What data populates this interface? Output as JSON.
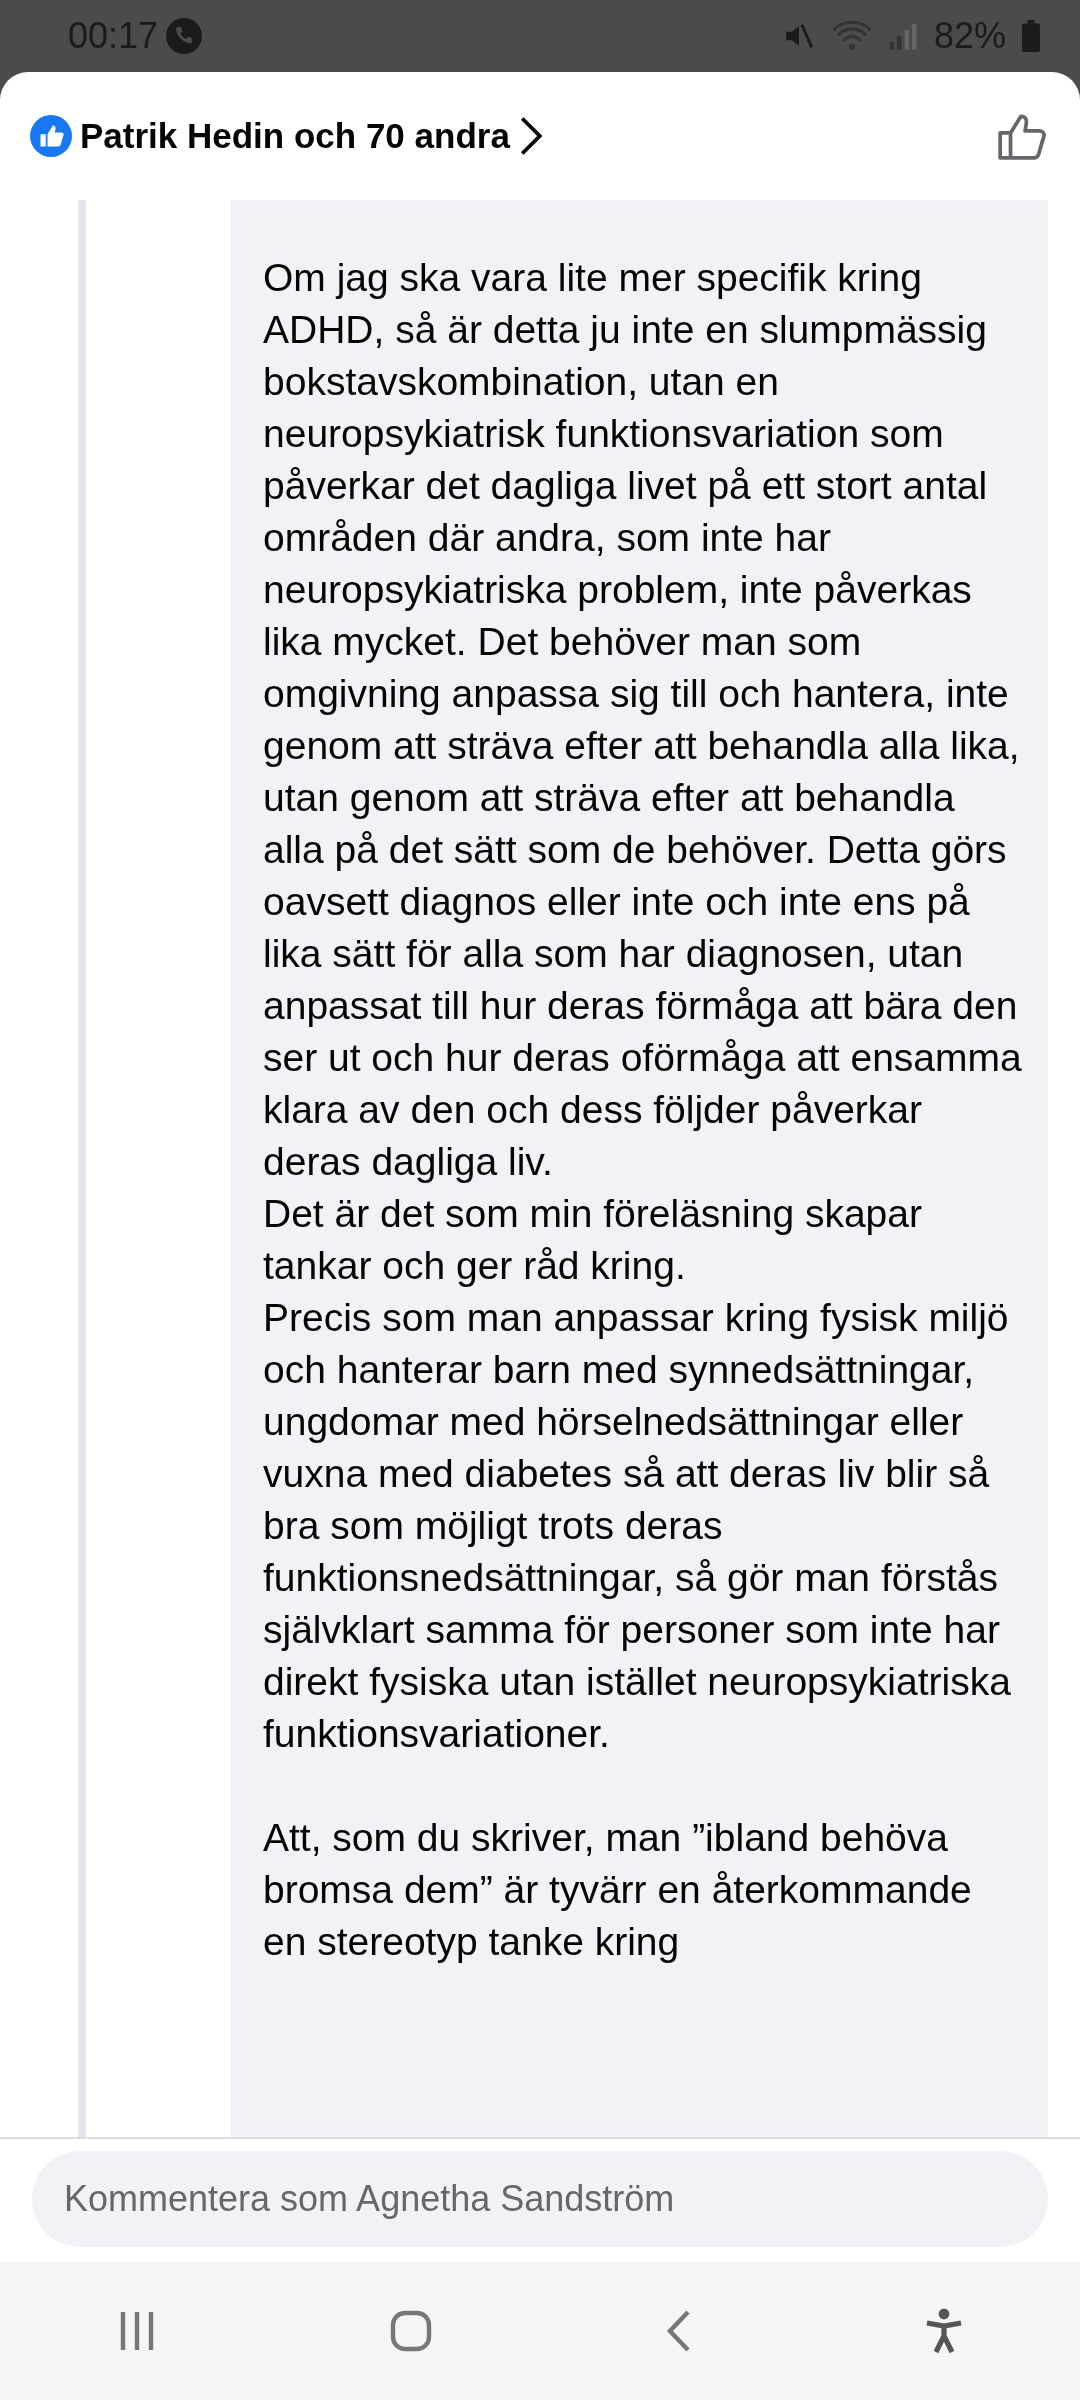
{
  "status_bar": {
    "time": "00:17",
    "battery": "82%"
  },
  "header": {
    "reactions_text": "Patrik Hedin och 70 andra",
    "liked": false
  },
  "comment": {
    "blocks": [
      {
        "paragraphs": [
          "Om jag ska vara lite mer specifik kring ADHD, så är detta ju inte en slumpmässig bokstavskombination, utan en neuropsykiatrisk funktionsvariation som påverkar det dagliga livet på ett stort antal områden där andra, som inte har neuropsykiatriska problem, inte påverkas lika mycket. Det behöver man som omgivning anpassa sig till och hantera, inte genom att sträva efter att behandla alla lika, utan genom att sträva efter att behandla alla på det sätt som de behöver. Detta görs oavsett diagnos eller inte och inte ens på lika sätt för alla som har diagnosen, utan anpassat till hur deras förmåga att bära den ser ut och hur deras oförmåga att ensamma klara av den och dess följder påverkar deras dagliga liv.",
          "Det är det som min föreläsning skapar tankar och ger råd kring.",
          "Precis som man anpassar kring fysisk miljö och hanterar barn med synnedsättningar, ungdomar med hörselnedsättningar eller vuxna med diabetes så att deras liv blir så bra som möjligt trots deras funktionsnedsättningar, så gör man förstås självklart samma för personer som inte har direkt fysiska utan istället neuropsykiatriska funktionsvariationer."
        ]
      },
      {
        "paragraphs": [
          "Att, som du skriver, man ”ibland behöva bromsa dem” är tyvärr en återkommande en stereotyp tanke kring"
        ]
      }
    ]
  },
  "composer": {
    "placeholder": "Kommentera som Agnetha Sandström"
  }
}
